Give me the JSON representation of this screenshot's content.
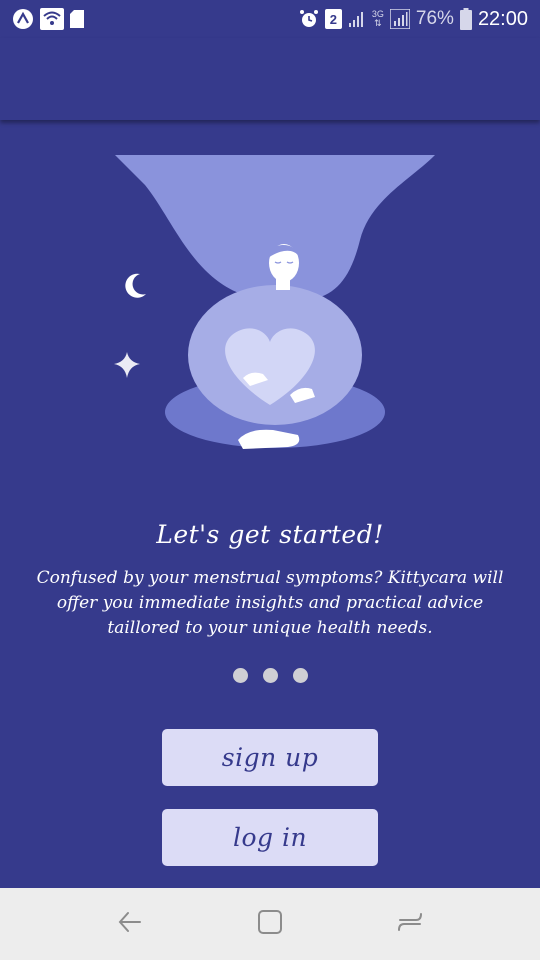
{
  "status_bar": {
    "battery_percent": "76%",
    "time": "22:00",
    "network_type": "3G",
    "notification_count": "2",
    "icons": [
      "app-a-icon",
      "wifi-icon",
      "sd-card-icon",
      "alarm-icon",
      "sim-2-icon",
      "signal-icon",
      "signal-icon",
      "battery-icon"
    ]
  },
  "illustration": {
    "icon": "meditating-woman-heart-illustration"
  },
  "onboarding": {
    "title": "Let's get started!",
    "description": "Confused by your menstrual symptoms? Kittycara will offer you immediate insights and practical advice taillored to your unique health needs.",
    "page_indicator": {
      "total": 3
    }
  },
  "buttons": {
    "sign_up": "sign up",
    "log_in": "log in"
  },
  "navigation": {
    "icons": [
      "back-icon",
      "home-icon",
      "recents-icon"
    ]
  },
  "colors": {
    "background": "#363a8c",
    "button_bg": "#dcdcf6",
    "button_text": "#363a8c",
    "nav_bar": "#ededed"
  }
}
